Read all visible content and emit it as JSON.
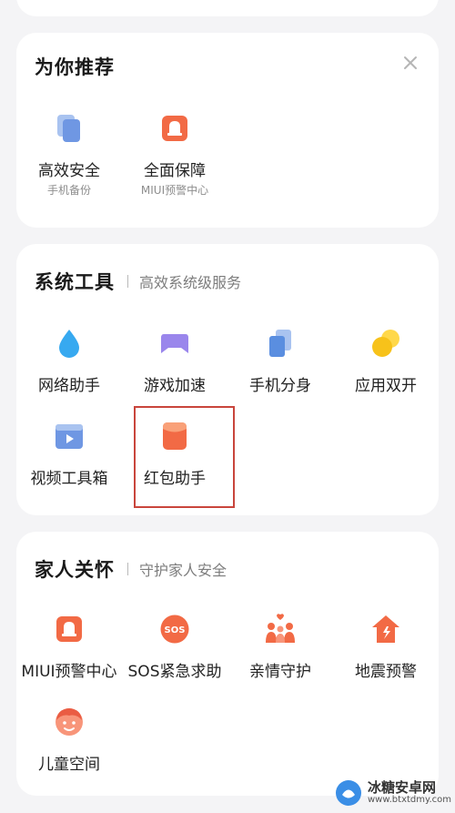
{
  "recommend": {
    "title": "为你推荐",
    "close_icon": "close-icon",
    "items": [
      {
        "label": "高效安全",
        "sublabel": "手机备份",
        "icon": "copy-icon"
      },
      {
        "label": "全面保障",
        "sublabel": "MIUI预警中心",
        "icon": "alert-bag-icon"
      }
    ]
  },
  "system_tools": {
    "title": "系统工具",
    "subtitle": "高效系统级服务",
    "items": [
      {
        "label": "网络助手",
        "icon": "water-drop-icon"
      },
      {
        "label": "游戏加速",
        "icon": "gamepad-icon"
      },
      {
        "label": "手机分身",
        "icon": "clone-icon"
      },
      {
        "label": "应用双开",
        "icon": "dual-circle-icon"
      },
      {
        "label": "视频工具箱",
        "icon": "video-icon"
      },
      {
        "label": "红包助手",
        "icon": "red-packet-icon"
      }
    ]
  },
  "family_care": {
    "title": "家人关怀",
    "subtitle": "守护家人安全",
    "items": [
      {
        "label": "MIUI预警中心",
        "icon": "alert-bag-icon"
      },
      {
        "label": "SOS紧急求助",
        "icon": "sos-icon",
        "icon_text": "SOS"
      },
      {
        "label": "亲情守护",
        "icon": "family-icon"
      },
      {
        "label": "地震预警",
        "icon": "earthquake-house-icon"
      },
      {
        "label": "儿童空间",
        "icon": "child-face-icon"
      }
    ]
  },
  "watermark": {
    "brand": "冰糖安卓网",
    "url": "www.btxtdmy.com",
    "icon": "watermark-logo-icon"
  },
  "colors": {
    "accent_orange": "#f26a45",
    "highlight_border": "#c9453c",
    "icon_blue": "#7fa6e6",
    "icon_purple": "#9a86ec",
    "icon_yellow": "#f7c21a"
  }
}
